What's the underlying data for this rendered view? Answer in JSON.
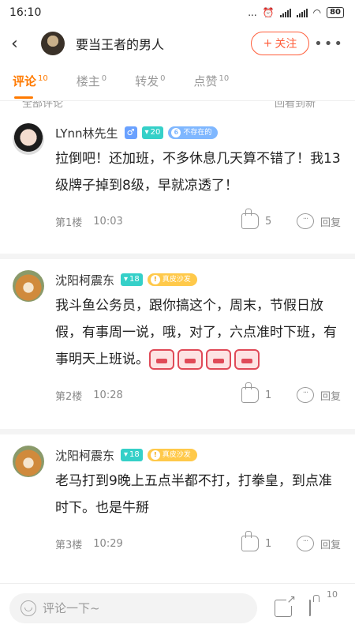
{
  "status_bar": {
    "time": "16:10",
    "dots": "...",
    "battery": "80"
  },
  "header": {
    "back_icon": "chevron-left-icon",
    "title": "要当王者的男人",
    "follow_label": "关注",
    "follow_plus": "+",
    "more": "•••"
  },
  "tabs": [
    {
      "label": "评论",
      "count": "10",
      "active": true
    },
    {
      "label": "楼主",
      "count": "0",
      "active": false
    },
    {
      "label": "转发",
      "count": "0",
      "active": false
    },
    {
      "label": "点赞",
      "count": "10",
      "active": false
    }
  ],
  "partial_header": {
    "left": "全部评论",
    "right": "回看到新"
  },
  "comments": [
    {
      "name": "LYnn林先生",
      "sex": "♂",
      "level": "20",
      "fan_num": "6",
      "fan_text": "不存在的",
      "text": "拉倒吧！还加班，不多休息几天算不错了！我13级牌子掉到8级，早就凉透了！",
      "floor": "第1楼",
      "time": "10:03",
      "likes": "5",
      "reply": "回复"
    },
    {
      "name": "沈阳柯震东",
      "level": "18",
      "rank_num": "!",
      "rank_text": "真皮沙发",
      "text": "我斗鱼公务员，跟你搞这个，周末，节假日放假，有事周一说，哦，对了，六点准时下班，有事明天上班说。",
      "floor": "第2楼",
      "time": "10:28",
      "likes": "1",
      "reply": "回复"
    },
    {
      "name": "沈阳柯震东",
      "level": "18",
      "rank_num": "!",
      "rank_text": "真皮沙发",
      "text": "老马打到9晚上五点半都不打，打拳皇，到点准时下。也是牛掰",
      "floor": "第3楼",
      "time": "10:29",
      "likes": "1",
      "reply": "回复"
    }
  ],
  "bottom": {
    "placeholder": "评论一下~",
    "like_count": "10"
  },
  "colors": {
    "accent": "#ff7a00",
    "follow": "#ff5d3a",
    "level": "#35d0c8"
  }
}
